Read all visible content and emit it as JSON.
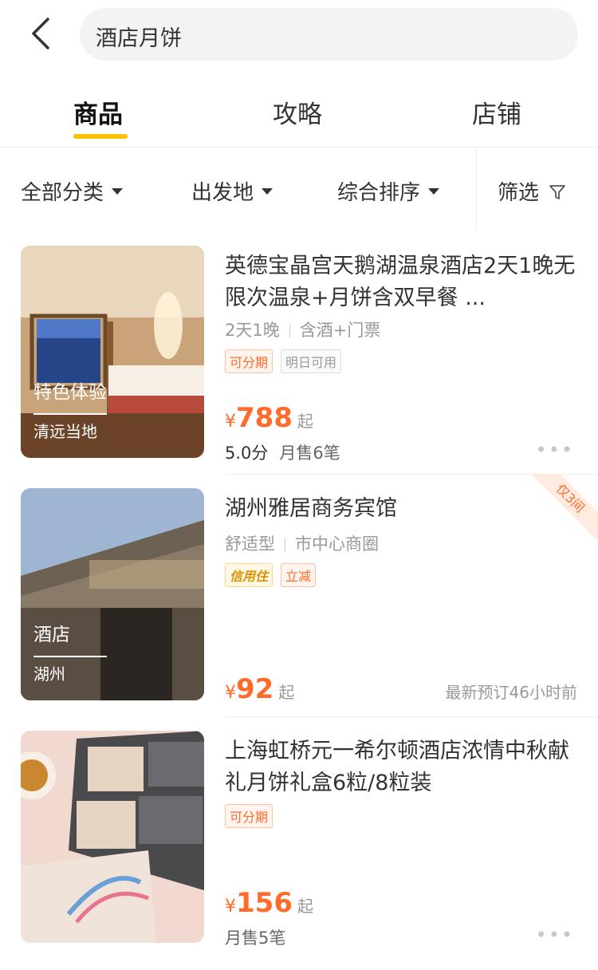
{
  "header": {
    "search_text": "酒店月饼"
  },
  "tabs": [
    {
      "label": "商品"
    },
    {
      "label": "攻略"
    },
    {
      "label": "店铺"
    }
  ],
  "filters": {
    "category": "全部分类",
    "origin": "出发地",
    "sort": "综合排序",
    "filter": "筛选"
  },
  "products": [
    {
      "title": "英德宝晶宫天鹅湖温泉酒店2天1晚无限次温泉+月饼含双早餐 ...",
      "thumb_tag1": "特色体验",
      "thumb_tag2": "清远当地",
      "sub1": "2天1晚",
      "sub2": "含酒+门票",
      "badge1": "可分期",
      "badge2": "明日可用",
      "currency": "¥",
      "price": "788",
      "price_suffix": "起",
      "score": "5.0分",
      "sales": "月售6笔"
    },
    {
      "title": "湖州雅居商务宾馆",
      "thumb_tag1": "酒店",
      "thumb_tag2": "湖州",
      "sub1": "舒适型",
      "sub2": "市中心商圈",
      "badge1": "信用住",
      "badge2": "立减",
      "currency": "¥",
      "price": "92",
      "price_suffix": "起",
      "recent": "最新预订46小时前",
      "ribbon": "仅3间"
    },
    {
      "title": "上海虹桥元一希尔顿酒店浓情中秋献礼月饼礼盒6粒/8粒装",
      "badge1": "可分期",
      "currency": "¥",
      "price": "156",
      "price_suffix": "起",
      "sales": "月售5笔"
    }
  ],
  "more_icon": "•••",
  "colors": {
    "accent": "#ffc107",
    "price": "#ff6b2b"
  }
}
